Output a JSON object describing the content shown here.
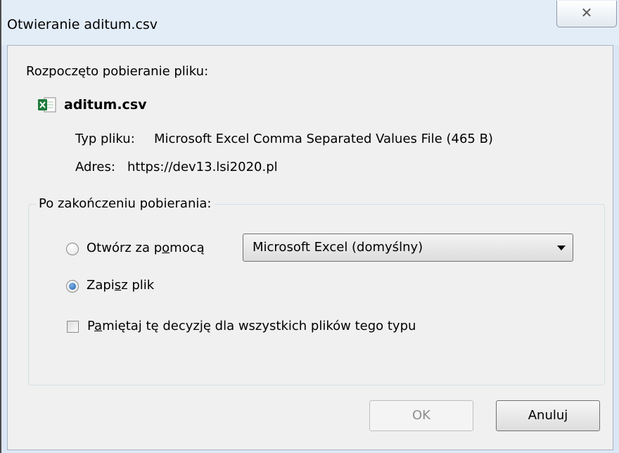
{
  "window": {
    "title": "Otwieranie aditum.csv",
    "close_glyph": "✕"
  },
  "download": {
    "heading": "Rozpoczęto pobieranie pliku:",
    "file_icon": "excel-csv-file-icon",
    "filename": "aditum.csv",
    "type_label": "Typ pliku:",
    "type_value": "Microsoft Excel Comma Separated Values File (465 B)",
    "address_label": "Adres:",
    "address_value": "https://dev13.lsi2020.pl"
  },
  "after_download": {
    "group_label": "Po zakończeniu pobierania:",
    "open_with": {
      "label_before": "Otwórz za p",
      "label_accel": "o",
      "label_after": "mocą",
      "selected": false
    },
    "app_select": {
      "value": "Microsoft Excel (domyślny)"
    },
    "save_file": {
      "label_before": "Zapi",
      "label_accel": "s",
      "label_after": "z plik",
      "selected": true
    },
    "remember": {
      "label_before": "P",
      "label_accel": "a",
      "label_after": "miętaj tę decyzję dla wszystkich plików tego typu",
      "checked": false
    }
  },
  "buttons": {
    "ok": "OK",
    "cancel": "Anuluj"
  },
  "colors": {
    "titlebar": "#e3edf8",
    "dialog_bg": "#f0f0f0",
    "radio_selected": "#1d5fa9"
  }
}
